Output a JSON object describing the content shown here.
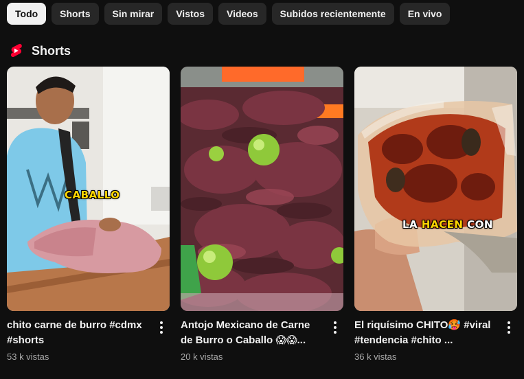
{
  "filters": [
    {
      "label": "Todo",
      "active": true
    },
    {
      "label": "Shorts",
      "active": false
    },
    {
      "label": "Sin mirar",
      "active": false
    },
    {
      "label": "Vistos",
      "active": false
    },
    {
      "label": "Videos",
      "active": false
    },
    {
      "label": "Subidos recientemente",
      "active": false
    },
    {
      "label": "En vivo",
      "active": false
    }
  ],
  "section": {
    "title": "Shorts",
    "icon": "youtube-shorts-icon",
    "accent": "#ff0033"
  },
  "shorts": [
    {
      "title": "chito carne de burro #cdmx #shorts",
      "views": "53 k vistas",
      "overlay": "CABALLO",
      "thumbnail": "man-cutting-meat"
    },
    {
      "title": "Antojo Mexicano de Carne de Burro o Caballo 😱😱...",
      "views": "20 k vistas",
      "overlay": "",
      "thumbnail": "dried-meat-with-limes"
    },
    {
      "title": "El riquísimo CHITO🥵 #viral #tendencia #chito ...",
      "views": "36 k vistas",
      "overlay_parts": [
        "LA",
        "HACEN",
        "CON"
      ],
      "thumbnail": "chito-in-bag"
    }
  ]
}
